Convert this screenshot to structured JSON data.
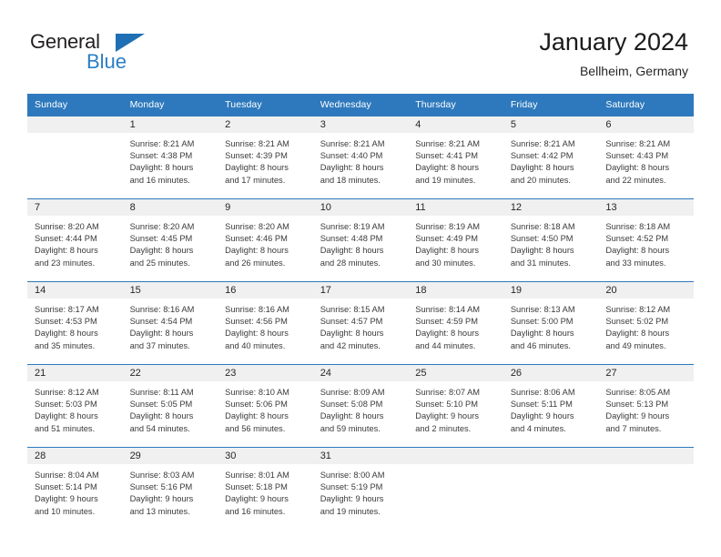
{
  "brand": {
    "word1": "General",
    "word2": "Blue",
    "triangle_color": "#1f6fb5",
    "word2_color": "#2b7fc4"
  },
  "header": {
    "title": "January 2024",
    "subtitle": "Bellheim, Germany"
  },
  "theme": {
    "header_blue": "#2e79bd",
    "daynum_band": "#f0f0f0",
    "text": "#3a3a3a"
  },
  "weekday_headers": [
    "Sunday",
    "Monday",
    "Tuesday",
    "Wednesday",
    "Thursday",
    "Friday",
    "Saturday"
  ],
  "weeks": [
    [
      {
        "day": "",
        "lines": []
      },
      {
        "day": "1",
        "lines": [
          "Sunrise: 8:21 AM",
          "Sunset: 4:38 PM",
          "Daylight: 8 hours",
          "and 16 minutes."
        ]
      },
      {
        "day": "2",
        "lines": [
          "Sunrise: 8:21 AM",
          "Sunset: 4:39 PM",
          "Daylight: 8 hours",
          "and 17 minutes."
        ]
      },
      {
        "day": "3",
        "lines": [
          "Sunrise: 8:21 AM",
          "Sunset: 4:40 PM",
          "Daylight: 8 hours",
          "and 18 minutes."
        ]
      },
      {
        "day": "4",
        "lines": [
          "Sunrise: 8:21 AM",
          "Sunset: 4:41 PM",
          "Daylight: 8 hours",
          "and 19 minutes."
        ]
      },
      {
        "day": "5",
        "lines": [
          "Sunrise: 8:21 AM",
          "Sunset: 4:42 PM",
          "Daylight: 8 hours",
          "and 20 minutes."
        ]
      },
      {
        "day": "6",
        "lines": [
          "Sunrise: 8:21 AM",
          "Sunset: 4:43 PM",
          "Daylight: 8 hours",
          "and 22 minutes."
        ]
      }
    ],
    [
      {
        "day": "7",
        "lines": [
          "Sunrise: 8:20 AM",
          "Sunset: 4:44 PM",
          "Daylight: 8 hours",
          "and 23 minutes."
        ]
      },
      {
        "day": "8",
        "lines": [
          "Sunrise: 8:20 AM",
          "Sunset: 4:45 PM",
          "Daylight: 8 hours",
          "and 25 minutes."
        ]
      },
      {
        "day": "9",
        "lines": [
          "Sunrise: 8:20 AM",
          "Sunset: 4:46 PM",
          "Daylight: 8 hours",
          "and 26 minutes."
        ]
      },
      {
        "day": "10",
        "lines": [
          "Sunrise: 8:19 AM",
          "Sunset: 4:48 PM",
          "Daylight: 8 hours",
          "and 28 minutes."
        ]
      },
      {
        "day": "11",
        "lines": [
          "Sunrise: 8:19 AM",
          "Sunset: 4:49 PM",
          "Daylight: 8 hours",
          "and 30 minutes."
        ]
      },
      {
        "day": "12",
        "lines": [
          "Sunrise: 8:18 AM",
          "Sunset: 4:50 PM",
          "Daylight: 8 hours",
          "and 31 minutes."
        ]
      },
      {
        "day": "13",
        "lines": [
          "Sunrise: 8:18 AM",
          "Sunset: 4:52 PM",
          "Daylight: 8 hours",
          "and 33 minutes."
        ]
      }
    ],
    [
      {
        "day": "14",
        "lines": [
          "Sunrise: 8:17 AM",
          "Sunset: 4:53 PM",
          "Daylight: 8 hours",
          "and 35 minutes."
        ]
      },
      {
        "day": "15",
        "lines": [
          "Sunrise: 8:16 AM",
          "Sunset: 4:54 PM",
          "Daylight: 8 hours",
          "and 37 minutes."
        ]
      },
      {
        "day": "16",
        "lines": [
          "Sunrise: 8:16 AM",
          "Sunset: 4:56 PM",
          "Daylight: 8 hours",
          "and 40 minutes."
        ]
      },
      {
        "day": "17",
        "lines": [
          "Sunrise: 8:15 AM",
          "Sunset: 4:57 PM",
          "Daylight: 8 hours",
          "and 42 minutes."
        ]
      },
      {
        "day": "18",
        "lines": [
          "Sunrise: 8:14 AM",
          "Sunset: 4:59 PM",
          "Daylight: 8 hours",
          "and 44 minutes."
        ]
      },
      {
        "day": "19",
        "lines": [
          "Sunrise: 8:13 AM",
          "Sunset: 5:00 PM",
          "Daylight: 8 hours",
          "and 46 minutes."
        ]
      },
      {
        "day": "20",
        "lines": [
          "Sunrise: 8:12 AM",
          "Sunset: 5:02 PM",
          "Daylight: 8 hours",
          "and 49 minutes."
        ]
      }
    ],
    [
      {
        "day": "21",
        "lines": [
          "Sunrise: 8:12 AM",
          "Sunset: 5:03 PM",
          "Daylight: 8 hours",
          "and 51 minutes."
        ]
      },
      {
        "day": "22",
        "lines": [
          "Sunrise: 8:11 AM",
          "Sunset: 5:05 PM",
          "Daylight: 8 hours",
          "and 54 minutes."
        ]
      },
      {
        "day": "23",
        "lines": [
          "Sunrise: 8:10 AM",
          "Sunset: 5:06 PM",
          "Daylight: 8 hours",
          "and 56 minutes."
        ]
      },
      {
        "day": "24",
        "lines": [
          "Sunrise: 8:09 AM",
          "Sunset: 5:08 PM",
          "Daylight: 8 hours",
          "and 59 minutes."
        ]
      },
      {
        "day": "25",
        "lines": [
          "Sunrise: 8:07 AM",
          "Sunset: 5:10 PM",
          "Daylight: 9 hours",
          "and 2 minutes."
        ]
      },
      {
        "day": "26",
        "lines": [
          "Sunrise: 8:06 AM",
          "Sunset: 5:11 PM",
          "Daylight: 9 hours",
          "and 4 minutes."
        ]
      },
      {
        "day": "27",
        "lines": [
          "Sunrise: 8:05 AM",
          "Sunset: 5:13 PM",
          "Daylight: 9 hours",
          "and 7 minutes."
        ]
      }
    ],
    [
      {
        "day": "28",
        "lines": [
          "Sunrise: 8:04 AM",
          "Sunset: 5:14 PM",
          "Daylight: 9 hours",
          "and 10 minutes."
        ]
      },
      {
        "day": "29",
        "lines": [
          "Sunrise: 8:03 AM",
          "Sunset: 5:16 PM",
          "Daylight: 9 hours",
          "and 13 minutes."
        ]
      },
      {
        "day": "30",
        "lines": [
          "Sunrise: 8:01 AM",
          "Sunset: 5:18 PM",
          "Daylight: 9 hours",
          "and 16 minutes."
        ]
      },
      {
        "day": "31",
        "lines": [
          "Sunrise: 8:00 AM",
          "Sunset: 5:19 PM",
          "Daylight: 9 hours",
          "and 19 minutes."
        ]
      },
      {
        "day": "",
        "lines": []
      },
      {
        "day": "",
        "lines": []
      },
      {
        "day": "",
        "lines": []
      }
    ]
  ]
}
